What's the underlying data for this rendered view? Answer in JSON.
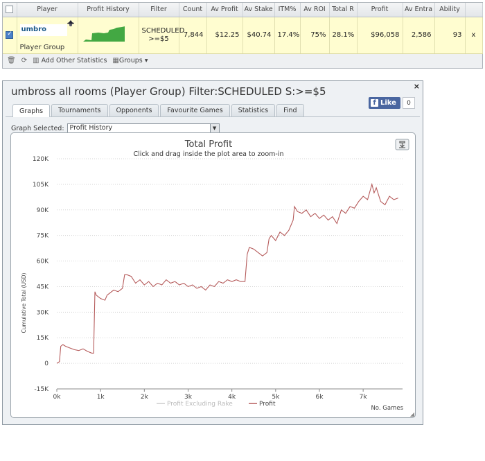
{
  "stats": {
    "headers": [
      "",
      "Player",
      "Profit History",
      "Filter",
      "Count",
      "Av Profit",
      "Av Stake",
      "ITM%",
      "Av ROI",
      "Total R",
      "Profit",
      "Av Entra",
      "Ability",
      ""
    ],
    "row": {
      "player_name": "umbro",
      "player_type": "Player Group",
      "filter": "SCHEDULED >=$5",
      "count": "7,844",
      "av_profit": "$12.25",
      "av_stake": "$40.74",
      "itm": "17.4%",
      "av_roi": "75%",
      "total_r": "28.1%",
      "profit": "$96,058",
      "av_entrants": "2,586",
      "ability": "93",
      "remove": "x"
    },
    "toolbar": {
      "add_other": "Add Other Statistics",
      "groups": "Groups"
    }
  },
  "panel": {
    "title": "umbross all rooms (Player Group) Filter:SCHEDULED S:>=$5",
    "close": "×",
    "tabs": [
      "Graphs",
      "Tournaments",
      "Opponents",
      "Favourite Games",
      "Statistics",
      "Find"
    ],
    "active_tab": "Graphs",
    "fb_like": "Like",
    "fb_count": "0",
    "graph_selected_label": "Graph Selected:",
    "graph_selected_value": "Profit History"
  },
  "chart_data": {
    "type": "line",
    "title": "Total Profit",
    "subtitle": "Click and drag inside the plot area to zoom-in",
    "xlabel": "No. Games",
    "ylabel": "Cumulative Total (USD)",
    "xlim": [
      0,
      7900
    ],
    "ylim": [
      -15000,
      120000
    ],
    "x_ticks": [
      0,
      1000,
      2000,
      3000,
      4000,
      5000,
      6000,
      7000
    ],
    "x_tick_labels": [
      "0k",
      "1k",
      "2k",
      "3k",
      "4k",
      "5k",
      "6k",
      "7k"
    ],
    "y_ticks": [
      -15000,
      0,
      15000,
      30000,
      45000,
      60000,
      75000,
      90000,
      105000,
      120000
    ],
    "y_tick_labels": [
      "-15K",
      "0",
      "15K",
      "30K",
      "45K",
      "60K",
      "75K",
      "90K",
      "105K",
      "120K"
    ],
    "grid": true,
    "legend_position": "bottom-center",
    "series": [
      {
        "name": "Profit Excluding Rake",
        "color": "#cccccc",
        "x": [],
        "y": []
      },
      {
        "name": "Profit",
        "color": "#b55a5a",
        "x": [
          0,
          60,
          90,
          140,
          200,
          300,
          400,
          500,
          600,
          700,
          800,
          840,
          870,
          900,
          1000,
          1100,
          1150,
          1200,
          1300,
          1400,
          1500,
          1550,
          1600,
          1700,
          1800,
          1900,
          2000,
          2100,
          2200,
          2300,
          2400,
          2500,
          2600,
          2700,
          2800,
          2900,
          3000,
          3100,
          3200,
          3300,
          3400,
          3500,
          3600,
          3700,
          3800,
          3900,
          4000,
          4100,
          4200,
          4300,
          4350,
          4400,
          4500,
          4600,
          4700,
          4800,
          4850,
          4900,
          5000,
          5100,
          5200,
          5300,
          5400,
          5430,
          5500,
          5600,
          5700,
          5800,
          5900,
          6000,
          6100,
          6200,
          6300,
          6400,
          6500,
          6600,
          6700,
          6800,
          6900,
          7000,
          7050,
          7100,
          7200,
          7250,
          7300,
          7400,
          7500,
          7600,
          7700,
          7800
        ],
        "y": [
          0,
          1000,
          10000,
          11000,
          10000,
          9000,
          8000,
          7500,
          8500,
          7000,
          6000,
          6000,
          42000,
          40000,
          38000,
          37000,
          40000,
          41000,
          43000,
          42000,
          44000,
          52000,
          52000,
          51000,
          47000,
          49000,
          46000,
          48000,
          45000,
          47000,
          46000,
          49000,
          47000,
          48000,
          46000,
          47000,
          45000,
          46000,
          44000,
          45000,
          43000,
          46000,
          45000,
          48000,
          47000,
          49000,
          48000,
          49000,
          48000,
          48000,
          64000,
          68000,
          67000,
          65000,
          63000,
          65000,
          73000,
          75000,
          72000,
          77000,
          75000,
          78000,
          84000,
          92000,
          89000,
          88000,
          90000,
          86000,
          88000,
          85000,
          87000,
          84000,
          86000,
          82000,
          90000,
          88000,
          92000,
          91000,
          95000,
          98000,
          97000,
          96000,
          105000,
          100000,
          103000,
          95000,
          93000,
          98000,
          96000,
          97000
        ]
      }
    ]
  }
}
